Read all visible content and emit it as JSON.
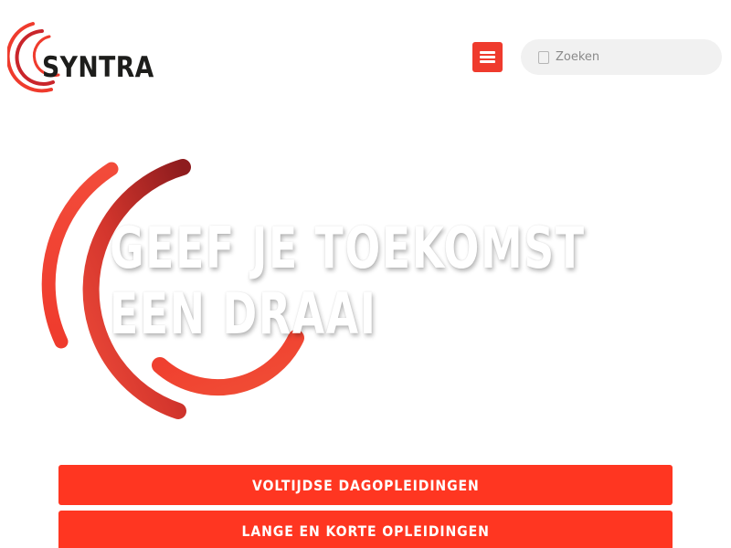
{
  "header": {
    "logo_text": "SYNTRA",
    "menu_icon": "hamburger-menu-icon",
    "search": {
      "placeholder": "Zoeken",
      "icon": "search-icon"
    }
  },
  "hero": {
    "title_line1": "GEEF JE TOEKOMST",
    "title_line2": "EEN DRAAI"
  },
  "cta_buttons": [
    {
      "label": "VOLTIJDSE DAGOPLEIDINGEN"
    },
    {
      "label": "LANGE EN KORTE OPLEIDINGEN"
    }
  ],
  "colors": {
    "brand_red": "#ef3b2d",
    "button_red": "#ff3621",
    "dark_red": "#8e1c1e",
    "search_bg": "#f1f1f1"
  }
}
